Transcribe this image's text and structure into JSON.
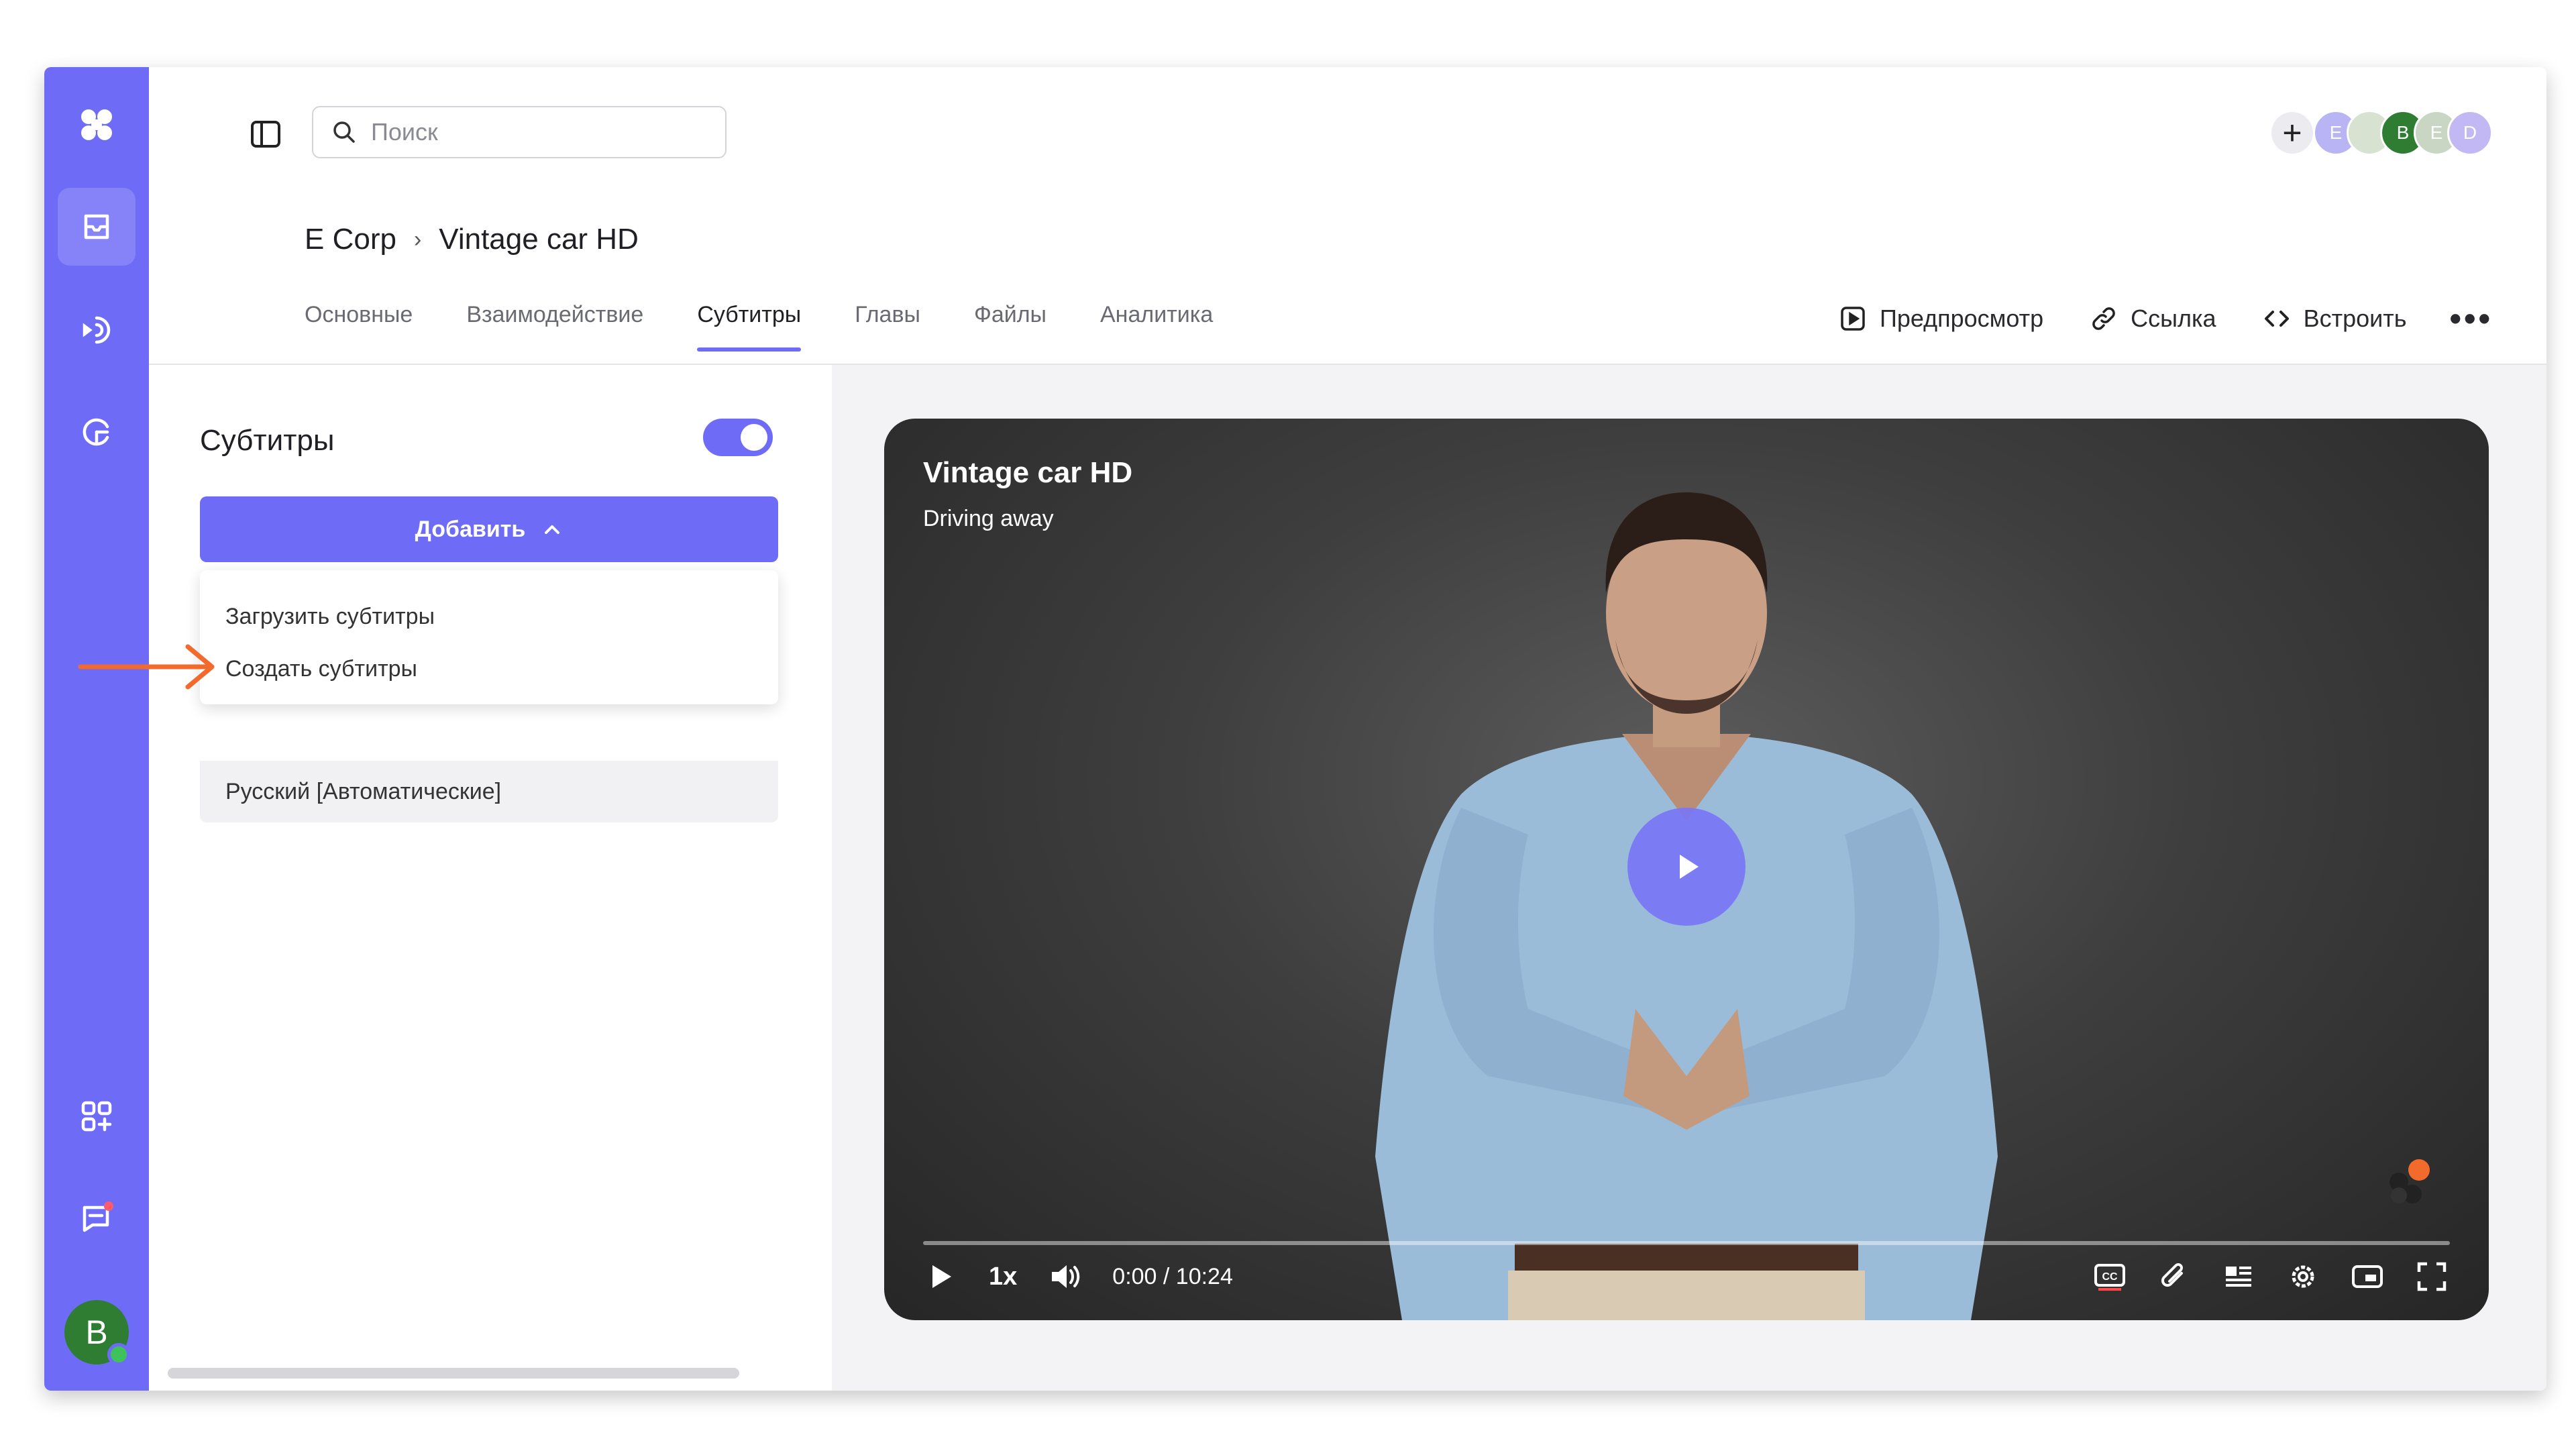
{
  "search": {
    "placeholder": "Поиск"
  },
  "header": {
    "avatars": [
      "E",
      "",
      "B",
      "E",
      "D"
    ]
  },
  "breadcrumb": {
    "workspace": "E Corp",
    "separator": "›",
    "video": "Vintage car HD"
  },
  "tabs": [
    "Основные",
    "Взаимодействие",
    "Субтитры",
    "Главы",
    "Файлы",
    "Аналитика"
  ],
  "active_tab": "Субтитры",
  "actions": {
    "preview": "Предпросмотр",
    "link": "Ссылка",
    "embed": "Встроить"
  },
  "subtitles_panel": {
    "title": "Субтитры",
    "enabled": true,
    "add_button": "Добавить",
    "menu": [
      "Загрузить субтитры",
      "Создать субтитры"
    ],
    "tracks": [
      "Русский [Автоматические]"
    ]
  },
  "user_avatar": "B",
  "video": {
    "title": "Vintage car HD",
    "subtitle": "Driving away",
    "speed": "1x",
    "time": "0:00 / 10:24",
    "progress": 0
  },
  "colors": {
    "accent": "#6e6cf6",
    "arrow": "#f26a2c"
  }
}
